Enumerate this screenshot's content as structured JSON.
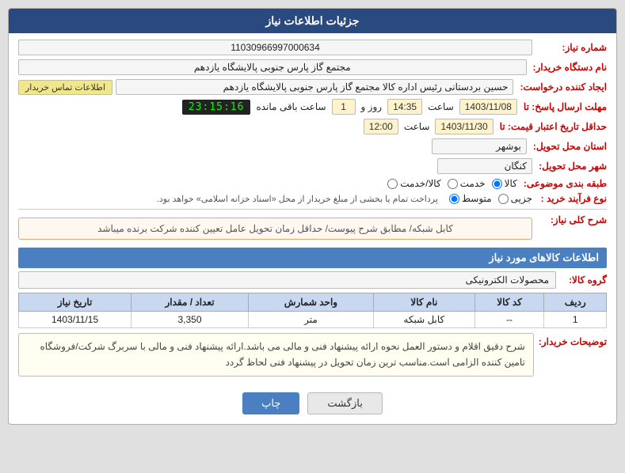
{
  "header": {
    "title": "جزئیات اطلاعات نیاز"
  },
  "fields": {
    "shomare_niaz_label": "شماره نیاز:",
    "shomare_niaz_value": "11030966997000634",
    "name_dastgah_label": "نام دستگاه خریدار:",
    "name_dastgah_value": "مجتمع گاز پارس جنوبی  پالایشگاه یازدهم",
    "idad_konande_label": "ایجاد کننده درخواست:",
    "idad_konande_value": "حسین بردستانی رئیس اداره کالا مجتمع گاز پارس جنوبی  پالایشگاه یازدهم",
    "etelaat_btn": "اطلاعات تماس خریدار",
    "mohlat_ersal_label": "مهلت ارسال پاسخ: تا",
    "mohlat_date": "1403/11/08",
    "mohlat_saat_label": "ساعت",
    "mohlat_saat": "14:35",
    "mohlat_rooz_label": "روز و",
    "mohlat_rooz": "1",
    "mohlat_bagi_label": "ساعت باقی مانده",
    "mohlat_timer": "23:15:16",
    "jadaval_label": "حداقل تاریخ اعتبار قیمت: تا",
    "jadaval_date": "1403/11/30",
    "jadaval_saat_label": "ساعت",
    "jadaval_saat": "12:00",
    "ostan_label": "استان محل تحویل:",
    "ostan_value": "بوشهر",
    "shahr_label": "شهر محل تحویل:",
    "shahr_value": "کنگان",
    "tabaghe_label": "طبقه بندی موضوعی:",
    "tabaghe_options": [
      "کالا",
      "خدمت",
      "کالا/خدمت"
    ],
    "tabaghe_selected": "کالا",
    "nooe_farayand_label": "نوع فرآیند خرید :",
    "nooe_options": [
      "جزیی",
      "متوسط"
    ],
    "nooe_selected": "متوسط",
    "nooe_note": "پرداخت تمام یا بخشی از مبلغ خریدار از محل «اسناد خزانه اسلامی» خواهد بود.",
    "sharh_label": "شرح کلی نیاز:",
    "sharh_text": "کابل شبکه/ مطابق شرح پیوست/ حداقل زمان تحویل عامل تعیین کننده شرکت برنده میباشد",
    "kalaha_title": "اطلاعات کالاهای مورد نیاز",
    "gorooh_label": "گروه کالا:",
    "gorooh_value": "محصولات الکترونیکی",
    "table": {
      "headers": [
        "ردیف",
        "کد کالا",
        "نام کالا",
        "واحد شمارش",
        "تعداد / مقدار",
        "تاریخ نیاز"
      ],
      "rows": [
        [
          "1",
          "--",
          "کابل شبکه",
          "متر",
          "3,350",
          "1403/11/15"
        ]
      ]
    },
    "towzih_label": "توضیحات خریدار:",
    "towzih_text": "شرح دقیق اقلام و دستور العمل نحوه ارائه پیشنهاد فنی و مالی می باشد.ارائه پیشنهاد فنی و مالی با سربرگ شرکت/فروشگاه تامین کننده الزامی است.مناسب ترین زمان تحویل در پیشنهاد فنی لحاظ گردد"
  },
  "buttons": {
    "print": "چاپ",
    "back": "بازگشت"
  }
}
